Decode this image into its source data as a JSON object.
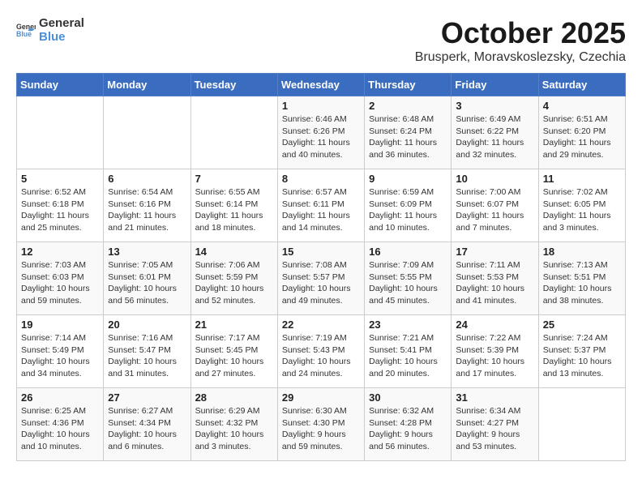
{
  "logo": {
    "line1": "General",
    "line2": "Blue"
  },
  "title": "October 2025",
  "subtitle": "Brusperk, Moravskoslezsky, Czechia",
  "header_days": [
    "Sunday",
    "Monday",
    "Tuesday",
    "Wednesday",
    "Thursday",
    "Friday",
    "Saturday"
  ],
  "weeks": [
    [
      {
        "day": "",
        "sunrise": "",
        "sunset": "",
        "daylight": ""
      },
      {
        "day": "",
        "sunrise": "",
        "sunset": "",
        "daylight": ""
      },
      {
        "day": "",
        "sunrise": "",
        "sunset": "",
        "daylight": ""
      },
      {
        "day": "1",
        "sunrise": "Sunrise: 6:46 AM",
        "sunset": "Sunset: 6:26 PM",
        "daylight": "Daylight: 11 hours and 40 minutes."
      },
      {
        "day": "2",
        "sunrise": "Sunrise: 6:48 AM",
        "sunset": "Sunset: 6:24 PM",
        "daylight": "Daylight: 11 hours and 36 minutes."
      },
      {
        "day": "3",
        "sunrise": "Sunrise: 6:49 AM",
        "sunset": "Sunset: 6:22 PM",
        "daylight": "Daylight: 11 hours and 32 minutes."
      },
      {
        "day": "4",
        "sunrise": "Sunrise: 6:51 AM",
        "sunset": "Sunset: 6:20 PM",
        "daylight": "Daylight: 11 hours and 29 minutes."
      }
    ],
    [
      {
        "day": "5",
        "sunrise": "Sunrise: 6:52 AM",
        "sunset": "Sunset: 6:18 PM",
        "daylight": "Daylight: 11 hours and 25 minutes."
      },
      {
        "day": "6",
        "sunrise": "Sunrise: 6:54 AM",
        "sunset": "Sunset: 6:16 PM",
        "daylight": "Daylight: 11 hours and 21 minutes."
      },
      {
        "day": "7",
        "sunrise": "Sunrise: 6:55 AM",
        "sunset": "Sunset: 6:14 PM",
        "daylight": "Daylight: 11 hours and 18 minutes."
      },
      {
        "day": "8",
        "sunrise": "Sunrise: 6:57 AM",
        "sunset": "Sunset: 6:11 PM",
        "daylight": "Daylight: 11 hours and 14 minutes."
      },
      {
        "day": "9",
        "sunrise": "Sunrise: 6:59 AM",
        "sunset": "Sunset: 6:09 PM",
        "daylight": "Daylight: 11 hours and 10 minutes."
      },
      {
        "day": "10",
        "sunrise": "Sunrise: 7:00 AM",
        "sunset": "Sunset: 6:07 PM",
        "daylight": "Daylight: 11 hours and 7 minutes."
      },
      {
        "day": "11",
        "sunrise": "Sunrise: 7:02 AM",
        "sunset": "Sunset: 6:05 PM",
        "daylight": "Daylight: 11 hours and 3 minutes."
      }
    ],
    [
      {
        "day": "12",
        "sunrise": "Sunrise: 7:03 AM",
        "sunset": "Sunset: 6:03 PM",
        "daylight": "Daylight: 10 hours and 59 minutes."
      },
      {
        "day": "13",
        "sunrise": "Sunrise: 7:05 AM",
        "sunset": "Sunset: 6:01 PM",
        "daylight": "Daylight: 10 hours and 56 minutes."
      },
      {
        "day": "14",
        "sunrise": "Sunrise: 7:06 AM",
        "sunset": "Sunset: 5:59 PM",
        "daylight": "Daylight: 10 hours and 52 minutes."
      },
      {
        "day": "15",
        "sunrise": "Sunrise: 7:08 AM",
        "sunset": "Sunset: 5:57 PM",
        "daylight": "Daylight: 10 hours and 49 minutes."
      },
      {
        "day": "16",
        "sunrise": "Sunrise: 7:09 AM",
        "sunset": "Sunset: 5:55 PM",
        "daylight": "Daylight: 10 hours and 45 minutes."
      },
      {
        "day": "17",
        "sunrise": "Sunrise: 7:11 AM",
        "sunset": "Sunset: 5:53 PM",
        "daylight": "Daylight: 10 hours and 41 minutes."
      },
      {
        "day": "18",
        "sunrise": "Sunrise: 7:13 AM",
        "sunset": "Sunset: 5:51 PM",
        "daylight": "Daylight: 10 hours and 38 minutes."
      }
    ],
    [
      {
        "day": "19",
        "sunrise": "Sunrise: 7:14 AM",
        "sunset": "Sunset: 5:49 PM",
        "daylight": "Daylight: 10 hours and 34 minutes."
      },
      {
        "day": "20",
        "sunrise": "Sunrise: 7:16 AM",
        "sunset": "Sunset: 5:47 PM",
        "daylight": "Daylight: 10 hours and 31 minutes."
      },
      {
        "day": "21",
        "sunrise": "Sunrise: 7:17 AM",
        "sunset": "Sunset: 5:45 PM",
        "daylight": "Daylight: 10 hours and 27 minutes."
      },
      {
        "day": "22",
        "sunrise": "Sunrise: 7:19 AM",
        "sunset": "Sunset: 5:43 PM",
        "daylight": "Daylight: 10 hours and 24 minutes."
      },
      {
        "day": "23",
        "sunrise": "Sunrise: 7:21 AM",
        "sunset": "Sunset: 5:41 PM",
        "daylight": "Daylight: 10 hours and 20 minutes."
      },
      {
        "day": "24",
        "sunrise": "Sunrise: 7:22 AM",
        "sunset": "Sunset: 5:39 PM",
        "daylight": "Daylight: 10 hours and 17 minutes."
      },
      {
        "day": "25",
        "sunrise": "Sunrise: 7:24 AM",
        "sunset": "Sunset: 5:37 PM",
        "daylight": "Daylight: 10 hours and 13 minutes."
      }
    ],
    [
      {
        "day": "26",
        "sunrise": "Sunrise: 6:25 AM",
        "sunset": "Sunset: 4:36 PM",
        "daylight": "Daylight: 10 hours and 10 minutes."
      },
      {
        "day": "27",
        "sunrise": "Sunrise: 6:27 AM",
        "sunset": "Sunset: 4:34 PM",
        "daylight": "Daylight: 10 hours and 6 minutes."
      },
      {
        "day": "28",
        "sunrise": "Sunrise: 6:29 AM",
        "sunset": "Sunset: 4:32 PM",
        "daylight": "Daylight: 10 hours and 3 minutes."
      },
      {
        "day": "29",
        "sunrise": "Sunrise: 6:30 AM",
        "sunset": "Sunset: 4:30 PM",
        "daylight": "Daylight: 9 hours and 59 minutes."
      },
      {
        "day": "30",
        "sunrise": "Sunrise: 6:32 AM",
        "sunset": "Sunset: 4:28 PM",
        "daylight": "Daylight: 9 hours and 56 minutes."
      },
      {
        "day": "31",
        "sunrise": "Sunrise: 6:34 AM",
        "sunset": "Sunset: 4:27 PM",
        "daylight": "Daylight: 9 hours and 53 minutes."
      },
      {
        "day": "",
        "sunrise": "",
        "sunset": "",
        "daylight": ""
      }
    ]
  ]
}
